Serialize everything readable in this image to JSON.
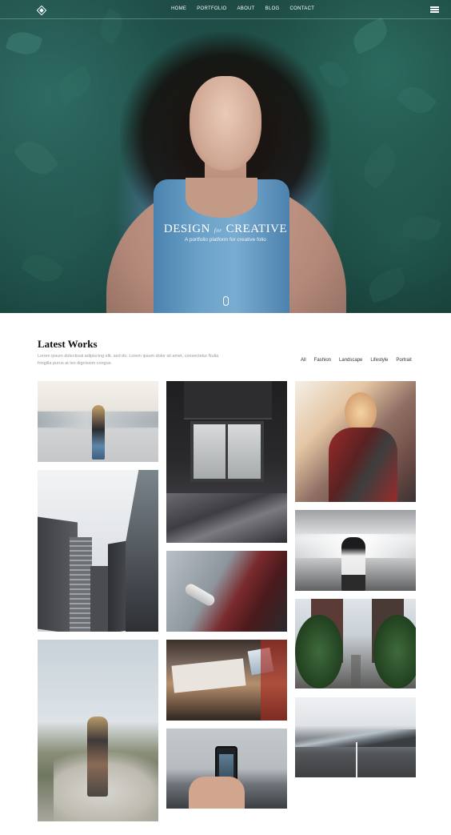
{
  "nav": {
    "items": [
      "HOME",
      "PORTFOLIO",
      "ABOUT",
      "BLOG",
      "CONTACT"
    ]
  },
  "hero": {
    "title_left": "DESIGN",
    "title_for": "for",
    "title_right": "CREATIVE",
    "subtitle": "A portfolio platform for creative folio"
  },
  "works": {
    "title": "Latest Works",
    "description": "Lorem ipsum dolectissii adipiscing elit, sed do. Lorem ipsum dolor sit amet, consectetur Nulla fringilla purus at leo dignissim congue.",
    "filters": [
      "All",
      "Fashion",
      "Landscape",
      "Lifestyle",
      "Portrait"
    ]
  },
  "colors": {
    "accent_white": "#ffffff",
    "hero_dark": "#0f2e2b",
    "text_dark": "#111111",
    "text_muted": "#9a9a9a"
  },
  "icons": [
    "logo-diamond-icon",
    "menu-hamburger-icon",
    "scroll-mouse-icon"
  ]
}
